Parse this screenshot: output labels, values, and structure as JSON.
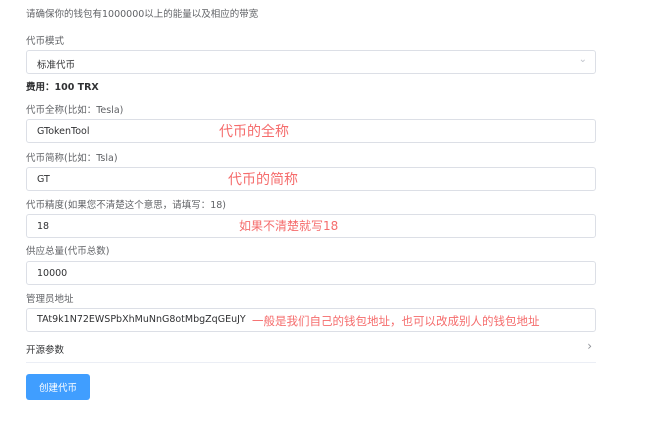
{
  "notice": "请确保你的钱包有1000000以上的能量以及相应的带宽",
  "token_mode": {
    "label": "代币模式",
    "selected": "标准代币"
  },
  "fee": "费用：100 TRX",
  "full_name": {
    "label": "代币全称(比如：Tesla)",
    "value": "GTokenTool",
    "annotation": "代币的全称"
  },
  "short_name": {
    "label": "代币简称(比如：Tsla)",
    "value": "GT",
    "annotation": "代币的简称"
  },
  "precision": {
    "label": "代币精度(如果您不清楚这个意思，请填写：18)",
    "value": "18",
    "annotation": "如果不清楚就写18"
  },
  "supply": {
    "label": "供应总量(代币总数)",
    "value": "10000"
  },
  "admin": {
    "label": "管理员地址",
    "value": "TAt9k1N72EWSPbXhMuNnG8otMbgZqGEuJY",
    "annotation": "一般是我们自己的钱包地址，也可以改成别人的钱包地址"
  },
  "open_source_params": "开源参数",
  "create_button": "创建代币",
  "colors": {
    "primary": "#409eff",
    "annotation": "#f56c6c",
    "border": "#dcdfe6"
  }
}
